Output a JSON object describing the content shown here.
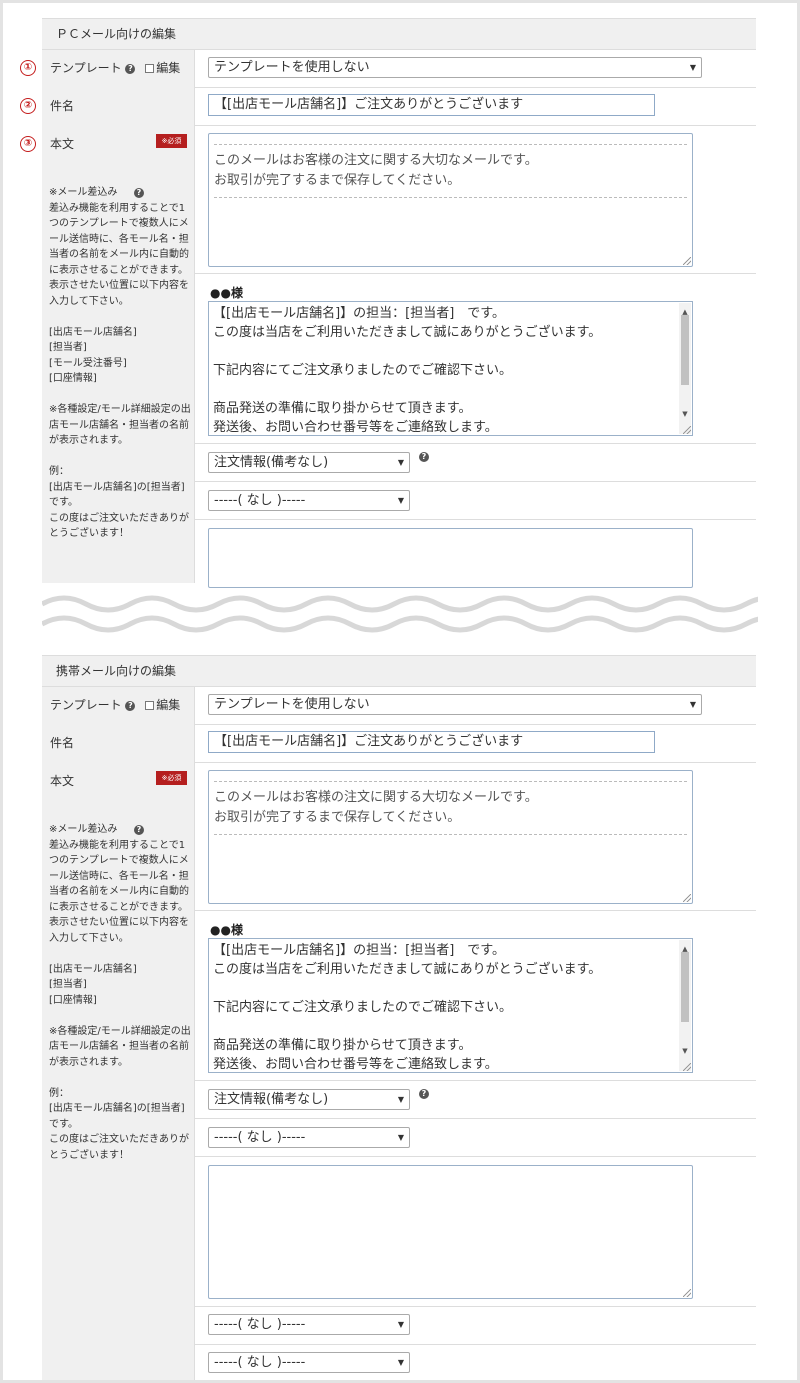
{
  "sections": [
    {
      "title": "ＰＣメール向けの編集",
      "template_label": "テンプレート",
      "edit_label": "編集",
      "template_select": "テンプレートを使用しない",
      "subject_label": "件名",
      "subject_value": "【[出店モール店舗名]】ご注文ありがとうございます",
      "body_label": "本文",
      "required_badge": "※必須",
      "notes": "※メール差込み\n差込み機能を利用することで1つのテンプレートで複数人にメール送信時に、各モール名・担当者の名前をメール内に自動的に表示させることができます。\n表示させたい位置に以下内容を入力して下さい。\n\n[出店モール店舗名]\n[担当者]\n[モール受注番号]\n[口座情報]\n\n※各種設定/モール詳細設定の出店モール店舗名・担当者の名前が表示されます。\n\n例：\n[出店モール店舗名]の[担当者]です。\nこの度はご注文いただきありがとうございます！",
      "header_text_lines": [
        "このメールはお客様の注文に関する大切なメールです。",
        "お取引が完了するまで保存してください。"
      ],
      "sama_label": "●●様",
      "body_lines": [
        "【[出店モール店舗名]】の担当：[担当者]　です。",
        "この度は当店をご利用いただきまして誠にありがとうございます。",
        "",
        "下記内容にてご注文承りましたのでご確認下さい。",
        "",
        "商品発送の準備に取り掛からせて頂きます。",
        "発送後、お問い合わせ番号等をご連絡致します。"
      ],
      "order_info_select": "注文情報(備考なし)",
      "none_select": "-----( なし )-----",
      "markers": [
        "①",
        "②",
        "③"
      ]
    },
    {
      "title": "携帯メール向けの編集",
      "template_label": "テンプレート",
      "edit_label": "編集",
      "template_select": "テンプレートを使用しない",
      "subject_label": "件名",
      "subject_value": "【[出店モール店舗名]】ご注文ありがとうございます",
      "body_label": "本文",
      "required_badge": "※必須",
      "notes": "※メール差込み\n差込み機能を利用することで1つのテンプレートで複数人にメール送信時に、各モール名・担当者の名前をメール内に自動的に表示させることができます。\n表示させたい位置に以下内容を入力して下さい。\n\n[出店モール店舗名]\n[担当者]\n[口座情報]\n\n※各種設定/モール詳細設定の出店モール店舗名・担当者の名前が表示されます。\n\n例：\n[出店モール店舗名]の[担当者]です。\nこの度はご注文いただきありがとうございます！",
      "header_text_lines": [
        "このメールはお客様の注文に関する大切なメールです。",
        "お取引が完了するまで保存してください。"
      ],
      "sama_label": "●●様",
      "body_lines": [
        "【[出店モール店舗名]】の担当：[担当者]　です。",
        "この度は当店をご利用いただきまして誠にありがとうございます。",
        "",
        "下記内容にてご注文承りましたのでご確認下さい。",
        "",
        "商品発送の準備に取り掛からせて頂きます。",
        "発送後、お問い合わせ番号等をご連絡致します。"
      ],
      "order_info_select": "注文情報(備考なし)",
      "none_select": "-----( なし )-----"
    }
  ],
  "icons": {
    "help": "question-circle-icon",
    "dropdown": "caret-down-icon",
    "resize": "resize-grip-icon"
  },
  "colors": {
    "required": "#b51f1f",
    "marker": "#c41d1d",
    "label_bg": "#f0f0f0"
  }
}
